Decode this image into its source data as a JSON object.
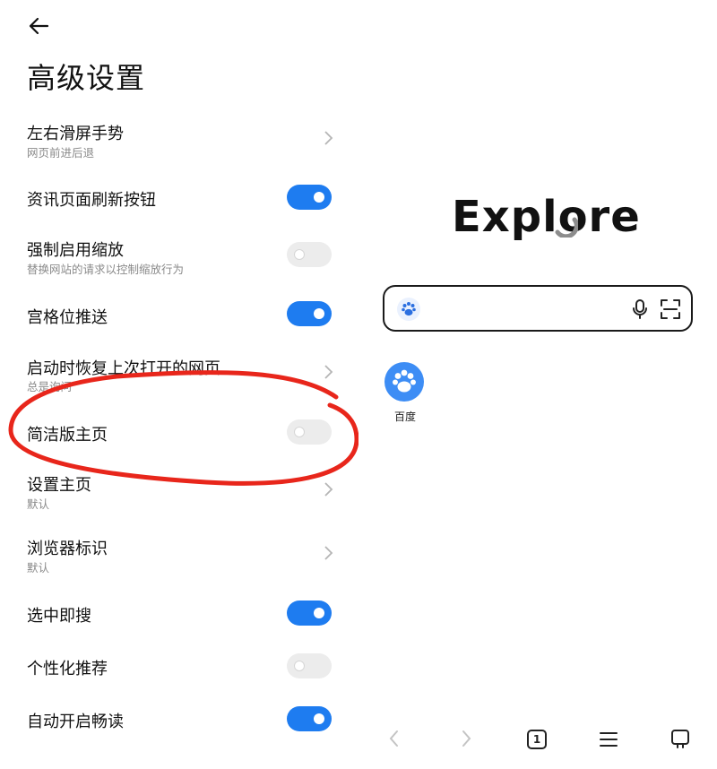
{
  "settings": {
    "title": "高级设置",
    "rows": [
      {
        "label": "左右滑屏手势",
        "sub": "网页前进后退",
        "control": "chevron"
      },
      {
        "label": "资讯页面刷新按钮",
        "sub": "",
        "control": "toggle",
        "on": true
      },
      {
        "label": "强制启用缩放",
        "sub": "替换网站的请求以控制缩放行为",
        "control": "toggle",
        "on": false
      },
      {
        "label": "宫格位推送",
        "sub": "",
        "control": "toggle",
        "on": true
      },
      {
        "label": "启动时恢复上次打开的网页",
        "sub": "总是询问",
        "control": "chevron"
      },
      {
        "label": "简洁版主页",
        "sub": "",
        "control": "toggle",
        "on": false
      },
      {
        "label": "设置主页",
        "sub": "默认",
        "control": "chevron"
      },
      {
        "label": "浏览器标识",
        "sub": "默认",
        "control": "chevron"
      },
      {
        "label": "选中即搜",
        "sub": "",
        "control": "toggle",
        "on": true
      },
      {
        "label": "个性化推荐",
        "sub": "",
        "control": "toggle",
        "on": false
      },
      {
        "label": "自动开启畅读",
        "sub": "",
        "control": "toggle",
        "on": true
      }
    ]
  },
  "browser": {
    "logo_text": "Explore",
    "search_engine_icon": "baidu-paw-icon",
    "shortcuts": [
      {
        "label": "百度",
        "icon": "baidu-paw-icon"
      }
    ],
    "tab_count": "1"
  },
  "colors": {
    "accent": "#1e7cf0",
    "toggle_off": "#ececec",
    "annotation": "#e8261b",
    "baidu_blue": "#3d8df5"
  }
}
